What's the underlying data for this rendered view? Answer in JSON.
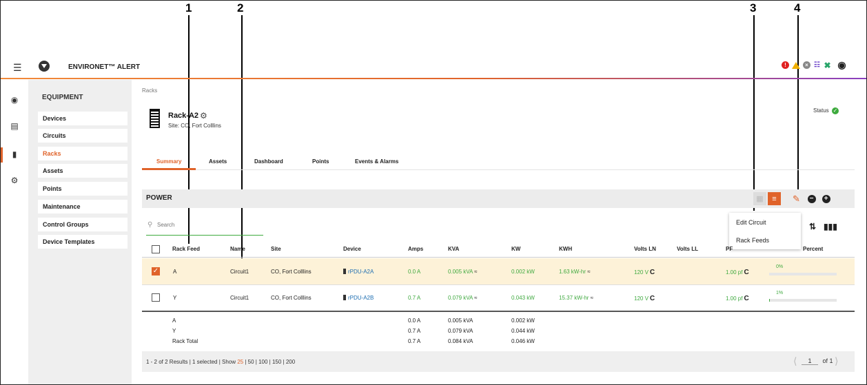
{
  "callouts": [
    "1",
    "2",
    "3",
    "4"
  ],
  "topbar": {
    "brand": "ENVIRONET™ ALERT"
  },
  "sidemenu": {
    "heading": "EQUIPMENT",
    "items": [
      "Devices",
      "Circuits",
      "Racks",
      "Assets",
      "Points",
      "Maintenance",
      "Control Groups",
      "Device Templates"
    ],
    "active": "Racks"
  },
  "breadcrumb": "Racks",
  "rack": {
    "title": "Rack-A2",
    "site": "Site: CO, Fort Colllins",
    "status_label": "Status"
  },
  "tabs": [
    "Summary",
    "Assets",
    "Dashboard",
    "Points",
    "Events & Alarms"
  ],
  "power": {
    "label": "POWER"
  },
  "dropdown": [
    "Edit Circuit",
    "Rack Feeds"
  ],
  "search": {
    "placeholder": "Search"
  },
  "table": {
    "headers": [
      "Rack Feed",
      "Name",
      "Site",
      "Device",
      "Amps",
      "KVA",
      "KW",
      "KWH",
      "Volts LN",
      "Volts LL",
      "PF",
      "Percent"
    ],
    "rows": [
      {
        "feed": "A",
        "name": "Circuit1",
        "site": "CO, Fort Colllins",
        "device": "rPDU-A2A",
        "amps": "0.0 A",
        "kva": "0.005 kVA",
        "kw": "0.002 kW",
        "kwh": "1.63 kW-hr",
        "volts_ln": "120 V",
        "pf": "1.00 pf",
        "percent_label": "0%",
        "percent": 0,
        "selected": true
      },
      {
        "feed": "Y",
        "name": "Circuit1",
        "site": "CO, Fort Colllins",
        "device": "rPDU-A2B",
        "amps": "0.7 A",
        "kva": "0.079 kVA",
        "kw": "0.043 kW",
        "kwh": "15.37 kW-hr",
        "volts_ln": "120 V",
        "pf": "1.00 pf",
        "percent_label": "1%",
        "percent": 1,
        "selected": false
      }
    ],
    "totals": [
      {
        "label": "A",
        "amps": "0.0 A",
        "kva": "0.005 kVA",
        "kw": "0.002 kW"
      },
      {
        "label": "Y",
        "amps": "0.7 A",
        "kva": "0.079 kVA",
        "kw": "0.044 kW"
      },
      {
        "label": "Rack Total",
        "amps": "0.7 A",
        "kva": "0.084 kVA",
        "kw": "0.046 kW"
      }
    ]
  },
  "footer": {
    "results": "1 - 2 of 2 Results | 1 selected | Show ",
    "show_active": "25",
    "show_rest": " | 50 | 100 | 150 | 200",
    "page": "1",
    "of_pages": "of 1"
  },
  "colors": {
    "accent": "#e0632a",
    "green": "#3fa93f",
    "selected_row": "#fdf2d8"
  }
}
